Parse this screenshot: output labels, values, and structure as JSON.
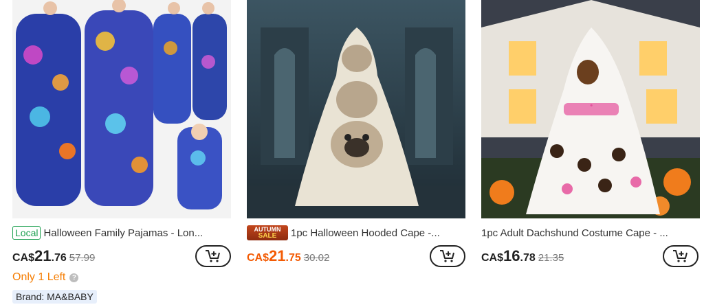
{
  "products": [
    {
      "badge": "Local",
      "title": "Halloween Family Pajamas - Lon...",
      "price": {
        "currency": "CA$",
        "int": "21",
        "dec": ".76",
        "original": "57.99"
      },
      "stock": "Only 1 Left",
      "brand": "Brand: MA&BABY"
    },
    {
      "badge_line1": "AUTUMN",
      "badge_line2": "SALE",
      "title": "1pc Halloween Hooded Cape -...",
      "price": {
        "currency": "CA$",
        "int": "21",
        "dec": ".75",
        "original": "30.02"
      }
    },
    {
      "title": "1pc Adult Dachshund Costume Cape - ...",
      "price": {
        "currency": "CA$",
        "int": "16",
        "dec": ".78",
        "original": "21.35"
      }
    }
  ],
  "colors": {
    "price_accent": "#f35b04",
    "stock": "#f57c00",
    "local_badge": "#1a9f4e"
  },
  "icons": {
    "cart": "add-to-cart-icon",
    "info": "info-icon"
  }
}
